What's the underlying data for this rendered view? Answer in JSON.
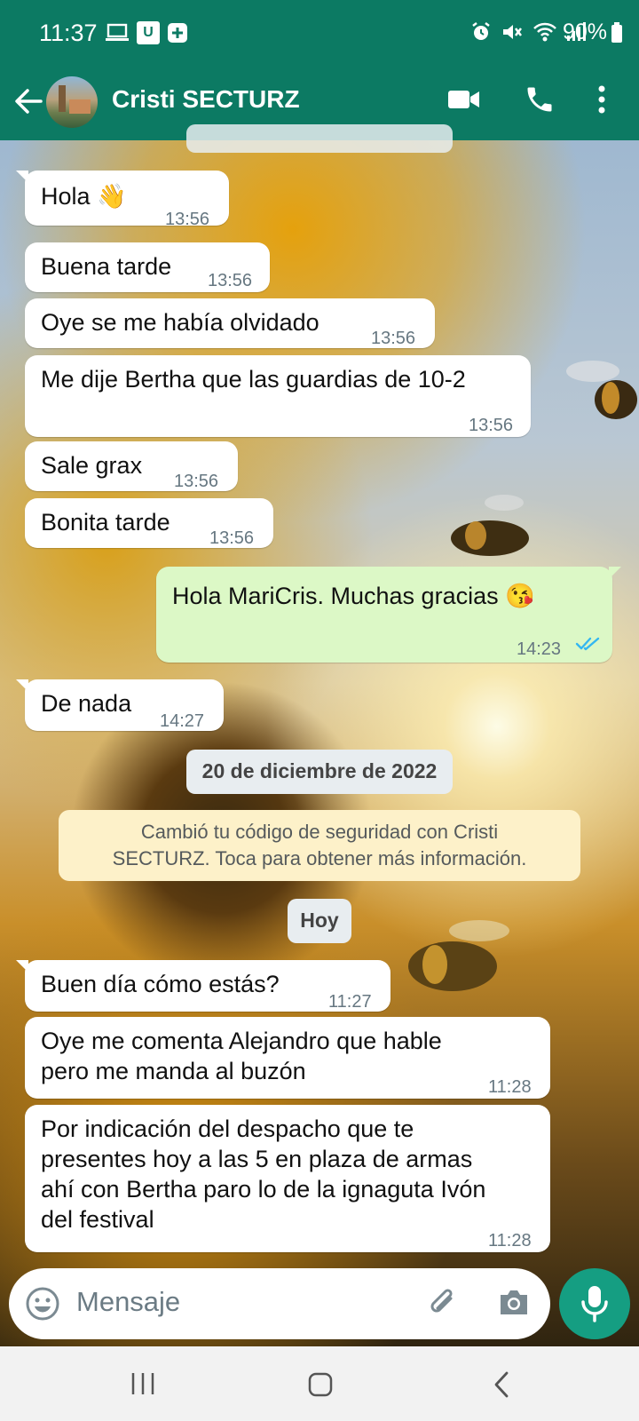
{
  "status_bar": {
    "time": "11:37",
    "battery": "90%",
    "left_icons": [
      "laptop-icon",
      "u-app-icon",
      "plus-icon"
    ],
    "right_icons": [
      "alarm-icon",
      "mute-icon",
      "wifi-icon",
      "signal-icon",
      "battery-icon"
    ]
  },
  "header": {
    "contact_name": "Cristi SECTURZ"
  },
  "messages": [
    {
      "dir": "in",
      "text": "Hola 👋",
      "time": "13:56"
    },
    {
      "dir": "in",
      "text": "Buena tarde",
      "time": "13:56"
    },
    {
      "dir": "in",
      "text": "Oye se me había olvidado",
      "time": "13:56"
    },
    {
      "dir": "in",
      "text": "Me dije Bertha que las guardias de 10-2",
      "time": "13:56"
    },
    {
      "dir": "in",
      "text": "Sale grax",
      "time": "13:56"
    },
    {
      "dir": "in",
      "text": "Bonita tarde",
      "time": "13:56"
    },
    {
      "dir": "out",
      "text": "Hola MariCris. Muchas  gracias 😘",
      "time": "14:23",
      "status": "read"
    },
    {
      "dir": "in",
      "text": "De nada",
      "time": "14:27"
    },
    {
      "dir": "in",
      "text": "Buen día cómo estás?",
      "time": "11:27"
    },
    {
      "dir": "in",
      "text": "Oye me comenta Alejandro que hable\npero me manda al buzón",
      "time": "11:28"
    },
    {
      "dir": "in",
      "text": "Por indicación del despacho que te\npresentes hoy a las 5 en plaza de armas\nahí con Bertha paro lo de la ignaguta Ivón\ndel festival",
      "time": "11:28"
    }
  ],
  "date_separators": {
    "first": "20 de diciembre de 2022",
    "second": "Hoy"
  },
  "system_message": "Cambió tu código de seguridad con Cristi\nSECTURZ. Toca para obtener más información.",
  "composer": {
    "placeholder": "Mensaje"
  },
  "colors": {
    "header_bg": "#0c7a63",
    "outgoing_bubble": "#dcf8c6",
    "incoming_bubble": "#ffffff",
    "mic_button": "#159e82",
    "read_ticks": "#34b7f1"
  }
}
